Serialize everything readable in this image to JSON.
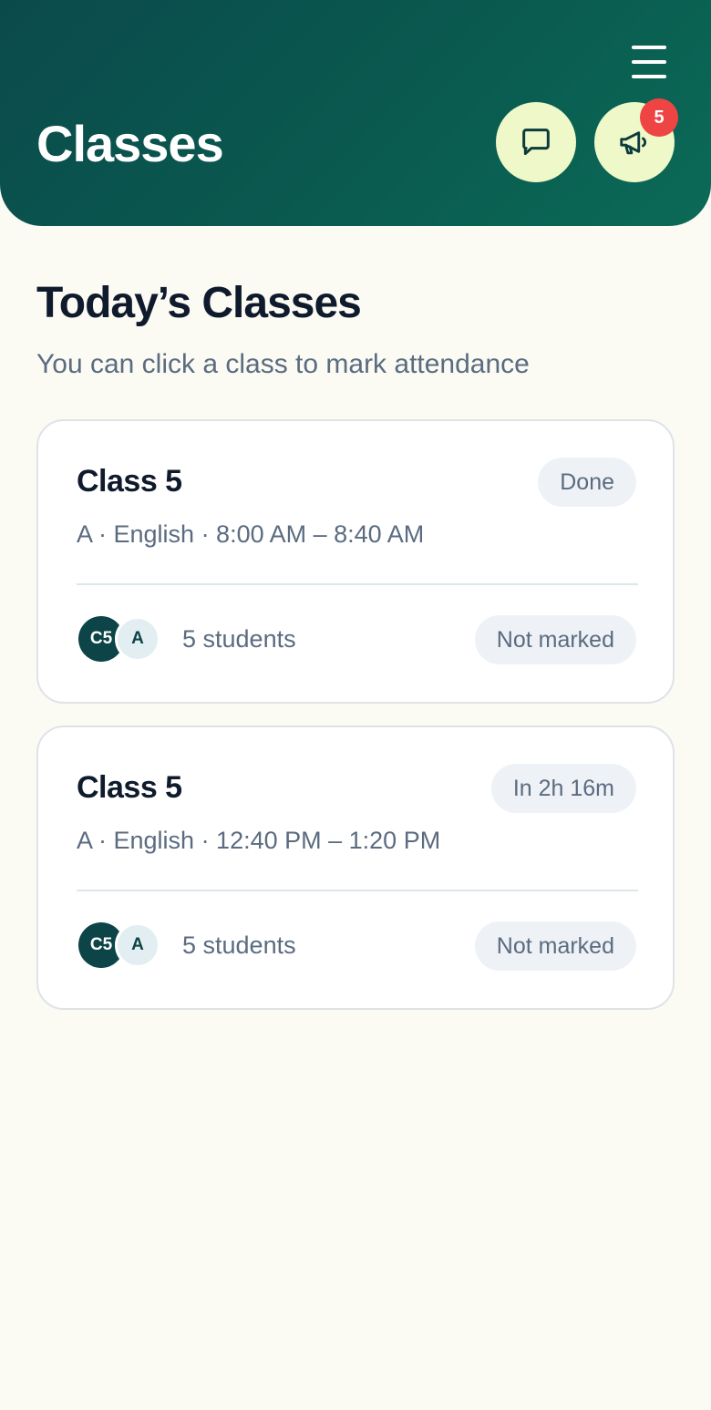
{
  "header": {
    "title": "Classes",
    "notification_count": "5",
    "icons": {
      "menu": "hamburger-menu-icon",
      "messages": "message-square-icon",
      "announcements": "megaphone-icon"
    },
    "colors": {
      "header_gradient_start": "#0b4a4c",
      "header_gradient_end": "#0b6a57",
      "icon_button_bg": "#eef8c8",
      "badge_bg": "#ef4444"
    }
  },
  "section": {
    "title": "Today’s Classes",
    "subtitle": "You can click a class to mark attendance"
  },
  "classes": [
    {
      "title": "Class 5",
      "status": "Done",
      "section": "A",
      "subject": "English",
      "time": "8:00 AM – 8:40 AM",
      "meta": "A · English · 8:00 AM – 8:40 AM",
      "avatars": [
        "C5",
        "A"
      ],
      "students": "5 students",
      "attendance": "Not marked"
    },
    {
      "title": "Class 5",
      "status": "In 2h 16m",
      "section": "A",
      "subject": "English",
      "time": "12:40 PM – 1:20 PM",
      "meta": "A · English · 12:40 PM – 1:20 PM",
      "avatars": [
        "C5",
        "A"
      ],
      "students": "5 students",
      "attendance": "Not marked"
    }
  ]
}
